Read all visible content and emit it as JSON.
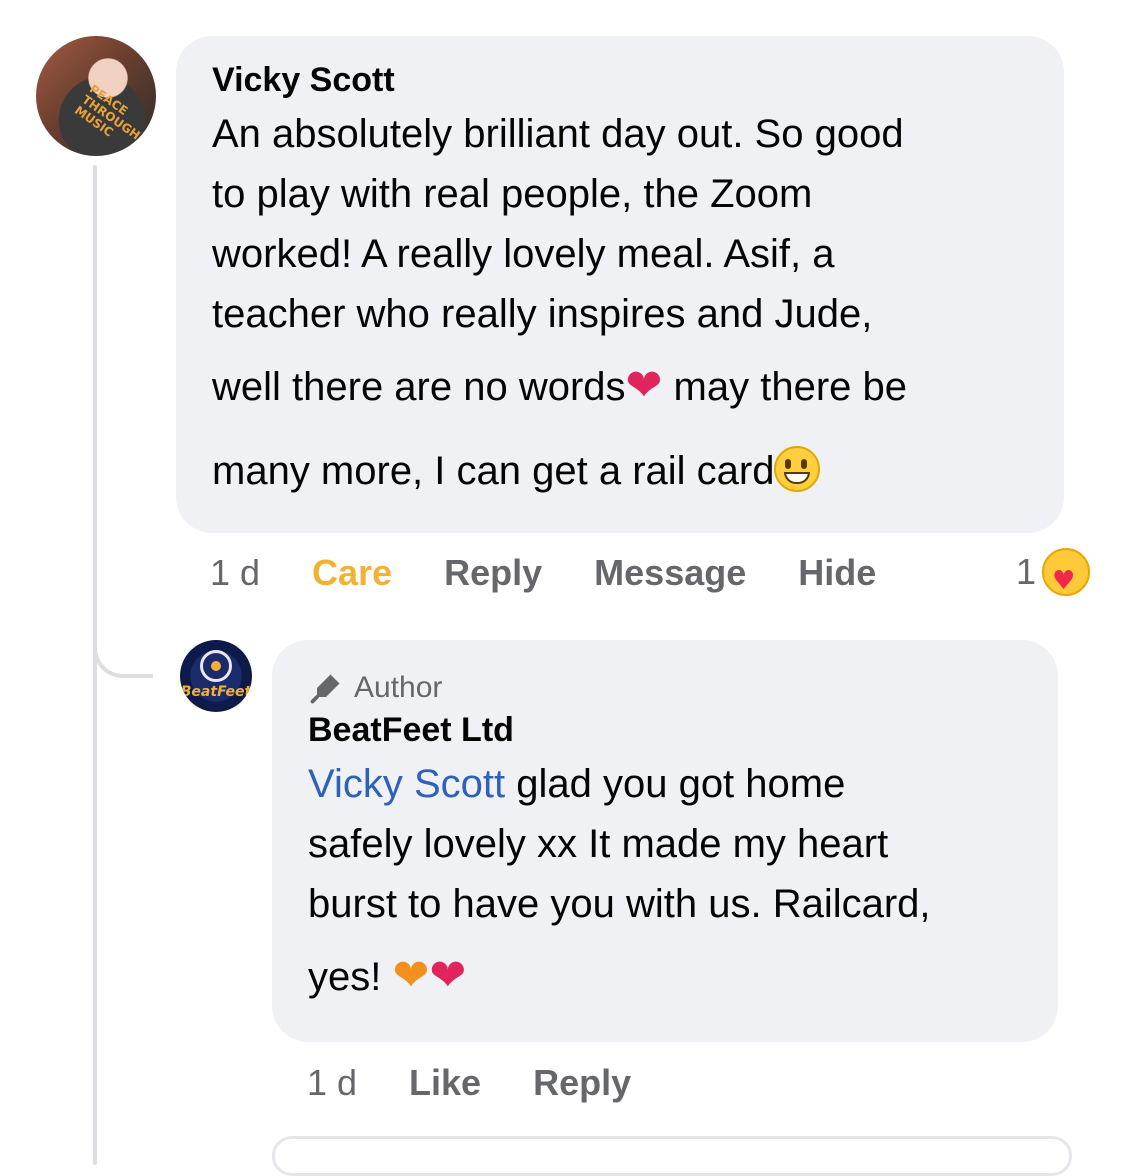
{
  "comment": {
    "author": "Vicky Scott",
    "lines": [
      "An absolutely brilliant day out. So good",
      "to play with real people, the Zoom",
      "worked! A really lovely meal. Asif, a",
      "teacher who really inspires and Jude,",
      "well there are no words",
      " may there be",
      "many more, I can get a rail card"
    ],
    "avatar_text": "PEACE THROUGH MUSIC",
    "time": "1 d",
    "actions": {
      "care": "Care",
      "reply": "Reply",
      "message": "Message",
      "hide": "Hide"
    },
    "reaction_count": "1",
    "reaction_icon": "care-emoji"
  },
  "reply": {
    "badge": "Author",
    "author": "BeatFeet Ltd",
    "mention": "Vicky Scott",
    "lines": [
      " glad you got home",
      "safely lovely xx It made my heart",
      "burst to have you with us. Railcard,",
      "yes! "
    ],
    "avatar_text": "BeatFeet",
    "time": "1 d",
    "actions": {
      "like": "Like",
      "reply": "Reply"
    }
  },
  "colors": {
    "bubble": "#f0f1f5",
    "care": "#f2b134",
    "mention": "#2e62b8",
    "meta": "#65676b"
  }
}
